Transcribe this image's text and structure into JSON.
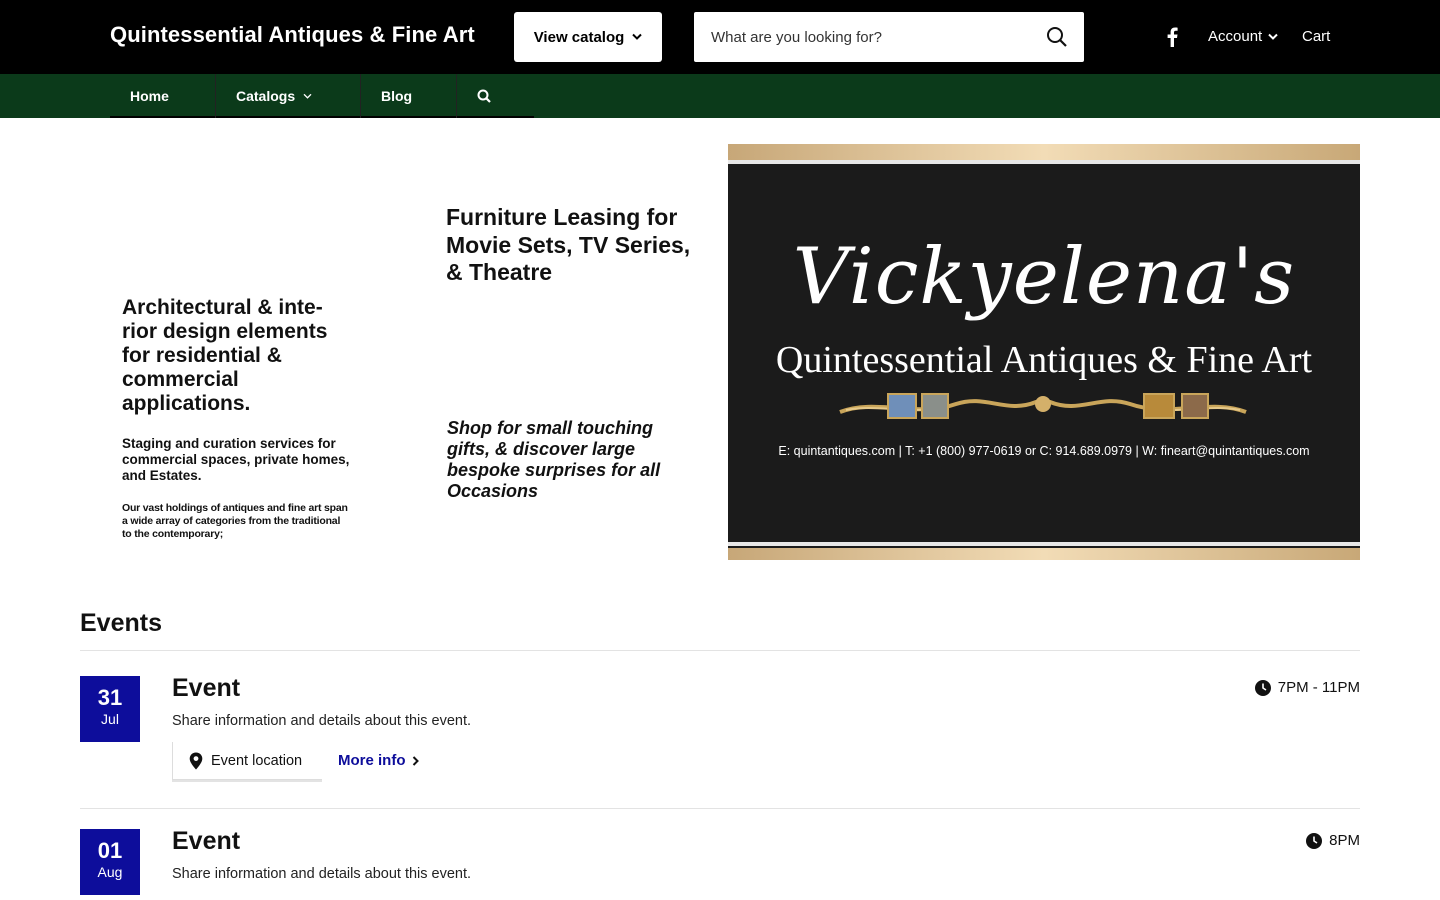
{
  "header": {
    "brand": "Quintessential Antiques & Fine Art",
    "view_catalog": "View catalog",
    "search_placeholder": "What are you looking for?",
    "account": "Account",
    "cart": "Cart"
  },
  "nav": {
    "items": [
      {
        "label": "Home"
      },
      {
        "label": "Catalogs"
      },
      {
        "label": "Blog"
      }
    ]
  },
  "hero": {
    "left_heading": "Architectural & inte-rior design elements for residential & commercial applications.",
    "left_sub": "Staging and curation services for commercial spaces, private homes, and Estates.",
    "left_small": "Our vast holdings of antiques and fine art span a wide array of categories from the traditional to the contemporary;",
    "mid_heading": "Furniture Leasing for Movie Sets, TV Series, & Theatre",
    "mid_italic": "Shop for small touching gifts, & discover large bespoke surprises for all Occasions"
  },
  "banner": {
    "script_name": "Vickyelena's",
    "subtitle": "Quintessential Antiques & Fine Art",
    "contact": "E: quintantiques.com | T: +1 (800) 977-0619 or C: 914.689.0979 | W: fineart@quintantiques.com"
  },
  "events": {
    "title": "Events",
    "items": [
      {
        "day": "31",
        "month": "Jul",
        "title": "Event",
        "description": "Share information and details about this event.",
        "time": "7PM - 11PM",
        "location": "Event location",
        "more_info": "More info"
      },
      {
        "day": "01",
        "month": "Aug",
        "title": "Event",
        "description": "Share information and details about this event.",
        "time": "8PM"
      }
    ]
  },
  "colors": {
    "topbar": "#000000",
    "navbar": "#0b3a1a",
    "accent": "#0d0d9b"
  }
}
